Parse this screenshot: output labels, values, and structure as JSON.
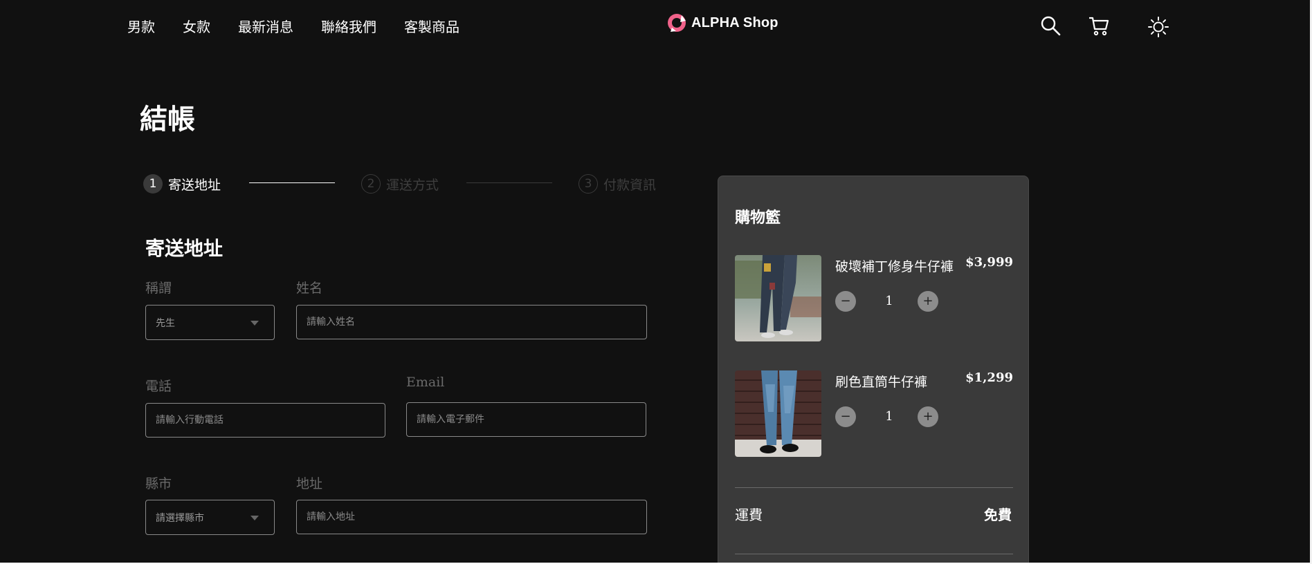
{
  "header": {
    "nav": [
      "男款",
      "女款",
      "最新消息",
      "聯絡我們",
      "客製商品"
    ],
    "logo_text": "ALPHA Shop",
    "icons": [
      "search-icon",
      "cart-icon",
      "theme-toggle-icon"
    ],
    "logo_color": "#f0628a"
  },
  "page_title": "結帳",
  "stepper": [
    {
      "num": "1",
      "label": "寄送地址",
      "state": "active"
    },
    {
      "num": "2",
      "label": "運送方式",
      "state": "inactive"
    },
    {
      "num": "3",
      "label": "付款資訊",
      "state": "inactive"
    }
  ],
  "form": {
    "section_title": "寄送地址",
    "salutation": {
      "label": "稱謂",
      "value": "先生"
    },
    "name": {
      "label": "姓名",
      "placeholder": "請輸入姓名"
    },
    "phone": {
      "label": "電話",
      "placeholder": "請輸入行動電話"
    },
    "email": {
      "label": "Email",
      "placeholder": "請輸入電子郵件"
    },
    "city": {
      "label": "縣市",
      "value": "請選擇縣市"
    },
    "address": {
      "label": "地址",
      "placeholder": "請輸入地址"
    }
  },
  "cart": {
    "title": "購物籃",
    "items": [
      {
        "name": "破壞補丁修身牛仔褲",
        "price": "$3,999",
        "qty": "1"
      },
      {
        "name": "刷色直筒牛仔褲",
        "price": "$1,299",
        "qty": "1"
      }
    ],
    "shipping_label": "運費",
    "shipping_value": "免費",
    "minus_symbol": "−",
    "plus_symbol": "+"
  }
}
